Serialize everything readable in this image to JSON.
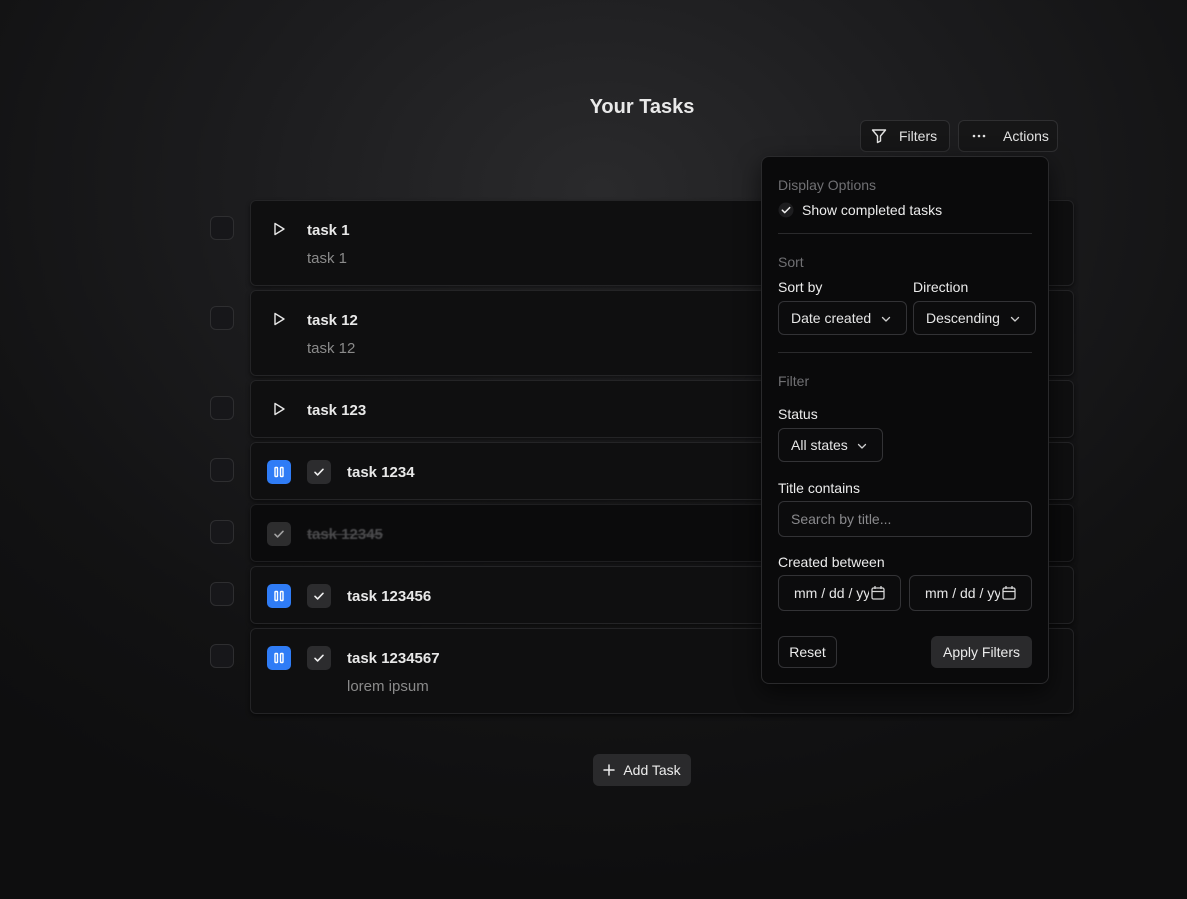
{
  "page": {
    "title": "Your Tasks"
  },
  "toolbar": {
    "filters_label": "Filters",
    "actions_label": "Actions"
  },
  "tasks": [
    {
      "title": "task 1",
      "subtitle": "task 1",
      "state": "idle"
    },
    {
      "title": "task 12",
      "subtitle": "task 12",
      "state": "idle"
    },
    {
      "title": "task 123",
      "subtitle": "",
      "state": "idle"
    },
    {
      "title": "task 1234",
      "subtitle": "",
      "state": "running"
    },
    {
      "title": "task 12345",
      "subtitle": "",
      "state": "completed"
    },
    {
      "title": "task 123456",
      "subtitle": "",
      "state": "running"
    },
    {
      "title": "task 1234567",
      "subtitle": "lorem ipsum",
      "state": "running"
    }
  ],
  "add_task_label": "Add Task",
  "filter_panel": {
    "display_section": "Display Options",
    "show_completed_label": "Show completed tasks",
    "show_completed_checked": true,
    "sort_section": "Sort",
    "sort_by_label": "Sort by",
    "sort_by_value": "Date created",
    "direction_label": "Direction",
    "direction_value": "Descending",
    "filter_section": "Filter",
    "status_label": "Status",
    "status_value": "All states",
    "title_contains_label": "Title contains",
    "title_placeholder": "Search by title...",
    "created_between_label": "Created between",
    "date_from_placeholder": "mm / dd / yyyy",
    "date_to_placeholder": "mm / dd / yyyy",
    "reset_label": "Reset",
    "apply_label": "Apply Filters"
  },
  "colors": {
    "accent": "#2f7cf6",
    "background": "#121213"
  },
  "icons": [
    "filter-icon",
    "more-horizontal-icon",
    "play-icon",
    "pause-icon",
    "check-icon",
    "chevron-down-icon",
    "calendar-icon",
    "plus-icon"
  ]
}
